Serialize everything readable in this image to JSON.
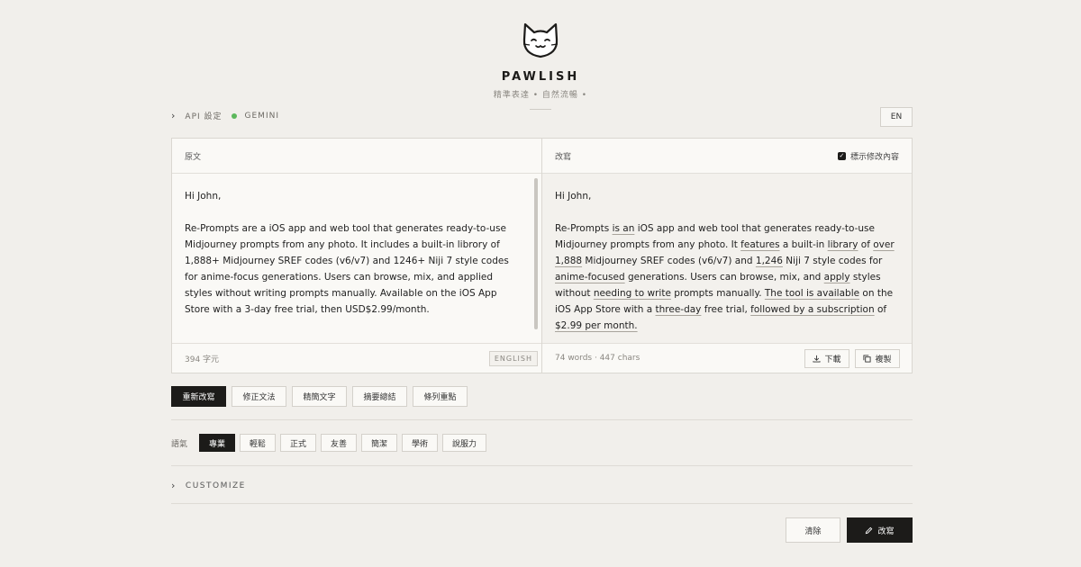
{
  "header": {
    "brand": "PAWLISH",
    "tagline": "精準表達 • 自然流暢 •",
    "logo_icon": "cat-face-icon"
  },
  "api": {
    "label": "API 設定",
    "provider": "GEMINI",
    "status_color": "#5cb85c"
  },
  "language_button": "EN",
  "source_pane": {
    "title": "原文",
    "greeting": "Hi John,",
    "paragraph": "Re-Prompts are a iOS app and web tool that generates ready-to-use Midjourney prompts from any photo. It includes a built-in librory of 1,888+ Midjourney SREF codes (v6/v7) and 1246+ Niji 7 style codes for anime-focus generations. Users can browse, mix, and applied styles without writing prompts manually. Available on the iOS App Store with a 3-day free trial, then USD$2.99/month.",
    "char_count": "394 字元",
    "detected_language": "ENGLISH"
  },
  "result_pane": {
    "title": "改寫",
    "show_changes_label": "標示修改內容",
    "show_changes_checked": true,
    "greeting": "Hi John,",
    "segments": [
      {
        "t": "Re-Prompts ",
        "u": false
      },
      {
        "t": "is an",
        "u": true
      },
      {
        "t": " iOS app and web tool that generates ready-to-use Midjourney prompts from any photo. It ",
        "u": false
      },
      {
        "t": "features",
        "u": true
      },
      {
        "t": " a built-in ",
        "u": false
      },
      {
        "t": "library",
        "u": true
      },
      {
        "t": " of ",
        "u": false
      },
      {
        "t": "over 1,888",
        "u": true
      },
      {
        "t": " Midjourney SREF codes (v6/v7) and ",
        "u": false
      },
      {
        "t": "1,246",
        "u": true
      },
      {
        "t": " Niji 7 style codes for ",
        "u": false
      },
      {
        "t": "anime-focused",
        "u": true
      },
      {
        "t": " generations. Users can browse, mix, and ",
        "u": false
      },
      {
        "t": "apply",
        "u": true
      },
      {
        "t": " styles without ",
        "u": false
      },
      {
        "t": "needing to write",
        "u": true
      },
      {
        "t": " prompts manually. ",
        "u": false
      },
      {
        "t": "The tool is available",
        "u": true
      },
      {
        "t": " on the iOS App Store with a ",
        "u": false
      },
      {
        "t": "three-day",
        "u": true
      },
      {
        "t": " free trial, ",
        "u": false
      },
      {
        "t": "followed by a subscription",
        "u": true
      },
      {
        "t": " of ",
        "u": false
      },
      {
        "t": "$2.99 per month.",
        "u": true
      }
    ],
    "stats": "74 words · 447 chars",
    "download_label": "下載",
    "copy_label": "複製"
  },
  "modes": [
    "重新改寫",
    "修正文法",
    "精簡文字",
    "摘要總結",
    "條列重點"
  ],
  "active_mode": 0,
  "tone": {
    "label": "語氣",
    "options": [
      "專業",
      "輕鬆",
      "正式",
      "友善",
      "簡潔",
      "學術",
      "說服力"
    ],
    "active": 0
  },
  "customize_label": "CUSTOMIZE",
  "actions": {
    "clear_label": "清除",
    "rewrite_label": "改寫"
  }
}
